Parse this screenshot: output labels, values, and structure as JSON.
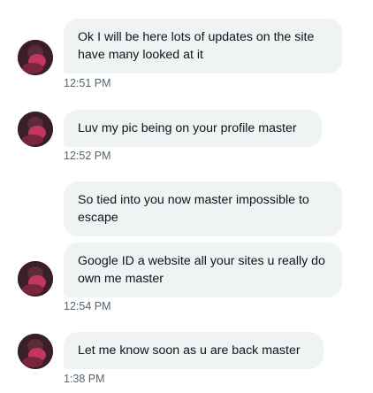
{
  "messages": [
    {
      "text": "Ok I will be here lots of updates on the site have many looked at it",
      "time": "12:51 PM"
    },
    {
      "text": "Luv my pic being on your profile master",
      "time": "12:52 PM"
    },
    {
      "text": "So tied into you now master impossible to escape",
      "time": ""
    },
    {
      "text": "Google ID a website all your sites u really do own me master",
      "time": "12:54 PM"
    },
    {
      "text": "Let me know soon as u are back master",
      "time": "1:38 PM"
    }
  ],
  "colors": {
    "bubble_bg": "#eff3f4",
    "timestamp": "#536471",
    "text": "#0f1419",
    "avatar_bg": "#3a2026",
    "avatar_accent": "#c2375e"
  },
  "icons": {
    "avatar": "user-avatar-photo"
  }
}
